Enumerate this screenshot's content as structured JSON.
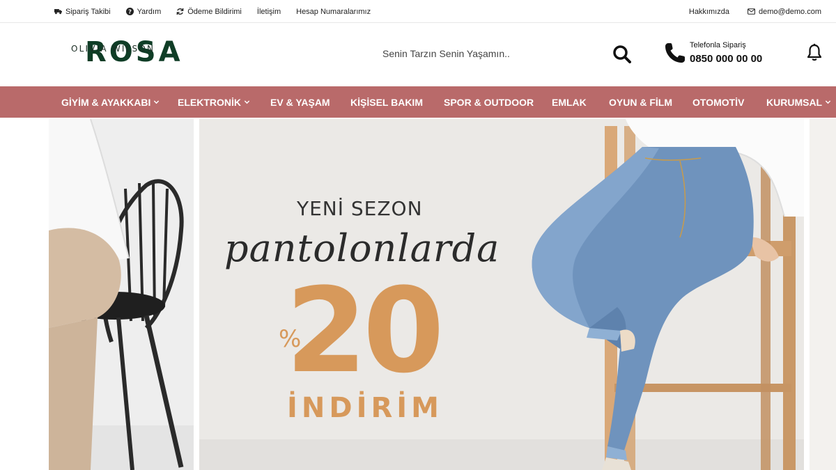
{
  "topbar": {
    "left_links": [
      {
        "label": "Sipariş Takibi",
        "icon": "truck-icon"
      },
      {
        "label": "Yardım",
        "icon": "question-circle-icon"
      },
      {
        "label": "Ödeme Bildirimi",
        "icon": "refresh-icon"
      },
      {
        "label": "İletişim",
        "icon": ""
      },
      {
        "label": "Hesap Numaralarımız",
        "icon": ""
      }
    ],
    "about_label": "Hakkımızda",
    "email_label": "demo@demo.com",
    "email_icon": "envelope-icon"
  },
  "header": {
    "logo_big": "ROSA",
    "logo_small": "OLIVIA WILSON",
    "search_placeholder": "Senin Tarzın Senin Yaşamın..",
    "search_icon": "search-icon",
    "phone_label": "Telefonla Sipariş",
    "phone_number": "0850 000 00 00",
    "phone_icon": "phone-icon",
    "bell_icon": "bell-icon"
  },
  "nav": {
    "items": [
      {
        "label": "GİYİM & AYAKKABI",
        "has_dropdown": true
      },
      {
        "label": "ELEKTRONİK",
        "has_dropdown": true
      },
      {
        "label": "EV & YAŞAM",
        "has_dropdown": false
      },
      {
        "label": "KİŞİSEL BAKIM",
        "has_dropdown": false
      },
      {
        "label": "SPOR & OUTDOOR",
        "has_dropdown": false
      },
      {
        "label": "EMLAK",
        "has_dropdown": false
      },
      {
        "label": "OYUN & FİLM",
        "has_dropdown": false
      },
      {
        "label": "OTOMOTİV",
        "has_dropdown": false
      },
      {
        "label": "KURUMSAL",
        "has_dropdown": true
      }
    ],
    "dropdown_icon": "chevron-down-icon"
  },
  "promo": {
    "line1": "YENİ SEZON",
    "line2": "pantolonlarda",
    "percent_sign": "%",
    "number": "20",
    "line4": "İNDİRİM"
  },
  "colors": {
    "nav_bg": "#b96a6a",
    "promo_accent": "#d7995b",
    "logo_green": "#0f3d26",
    "slide_bg": "#ebe9e6"
  }
}
